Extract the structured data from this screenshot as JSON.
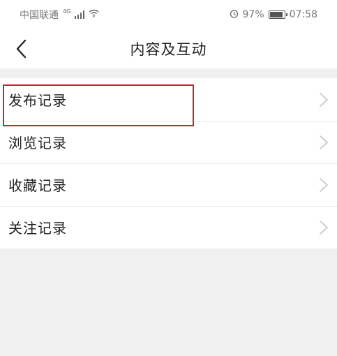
{
  "status_bar": {
    "carrier": "中国联通",
    "network": "4G",
    "battery_percent": "97%",
    "battery_level": 0.97,
    "time": "07:58",
    "icons": [
      "signal-icon",
      "wifi-icon",
      "alarm-icon",
      "battery-icon"
    ]
  },
  "nav": {
    "back_icon": "chevron-left-icon",
    "title": "内容及互动"
  },
  "menu": {
    "items": [
      {
        "label": "发布记录",
        "id": "publish-record"
      },
      {
        "label": "浏览记录",
        "id": "browse-record"
      },
      {
        "label": "收藏记录",
        "id": "favorite-record",
        "highlighted": true
      },
      {
        "label": "关注记录",
        "id": "follow-record"
      }
    ]
  },
  "colors": {
    "highlight_border": "#c0282f",
    "background": "#f0f0f0",
    "chevron": "#c8c8c8"
  }
}
